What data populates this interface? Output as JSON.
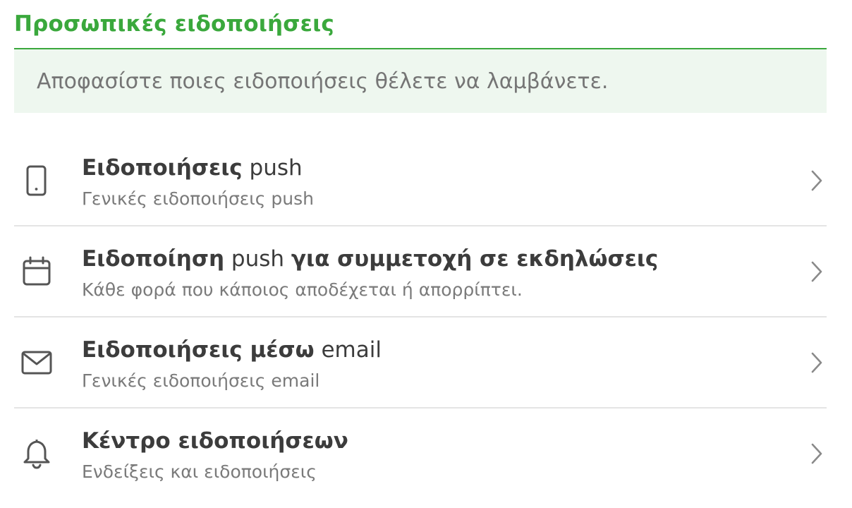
{
  "header": {
    "title": "Προσωπικές ειδοποιήσεις",
    "description": "Αποφασίστε ποιες ειδοποιήσεις θέλετε να λαμβάνετε."
  },
  "items": [
    {
      "icon": "phone-icon",
      "title_parts": [
        "Ειδοποιήσεις",
        " push"
      ],
      "subtitle": "Γενικές ειδοποιήσεις push"
    },
    {
      "icon": "calendar-icon",
      "title_parts": [
        "Ειδοποίηση",
        " push ",
        "για συμμετοχή σε εκδηλώσεις"
      ],
      "subtitle": "Κάθε φορά που κάποιος αποδέχεται ή απορρίπτει."
    },
    {
      "icon": "envelope-icon",
      "title_parts": [
        "Ειδοποιήσεις μέσω",
        " email"
      ],
      "subtitle": "Γενικές ειδοποιήσεις email"
    },
    {
      "icon": "bell-icon",
      "title_parts": [
        "Κέντρο ειδοποιήσεων"
      ],
      "subtitle": "Ενδείξεις και ειδοποιήσεις"
    }
  ],
  "colors": {
    "accent": "#3aa83c",
    "banner_bg": "#eef7ef",
    "text_dark": "#3c3c3c",
    "text_muted": "#7a7a7a",
    "divider": "#e4e4e4"
  }
}
